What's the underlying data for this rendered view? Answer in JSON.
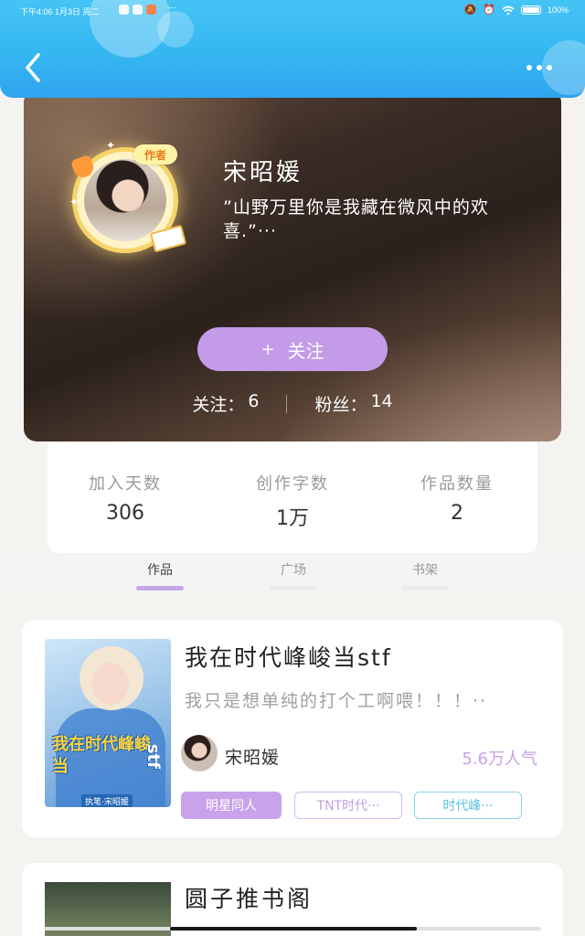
{
  "status_bar": {
    "time": "下午4:06  1月3日 周二",
    "dots": "···",
    "battery_pct": "100%"
  },
  "header": {
    "back_icon": "chevron-left-icon",
    "more_icon": "more-dots-icon"
  },
  "profile": {
    "badge": "作者",
    "name": "宋昭媛",
    "bio": "”山野万里你是我藏在微风中的欢喜.”···",
    "follow_button": "关注",
    "follow_plus": "+",
    "following_label": "关注：",
    "following_value": "6",
    "fans_label": "粉丝：",
    "fans_value": "14"
  },
  "stats": [
    {
      "label": "加入天数",
      "value": "306"
    },
    {
      "label": "创作字数",
      "value": "1万"
    },
    {
      "label": "作品数量",
      "value": "2"
    }
  ],
  "tabs": [
    {
      "label": "作品",
      "active": true
    },
    {
      "label": "广场",
      "active": false
    },
    {
      "label": "书架",
      "active": false
    }
  ],
  "books": [
    {
      "title": "我在时代峰峻当stf",
      "description": "我只是想单纯的打个工啊喂！！！··",
      "author": "宋昭媛",
      "readers": "5.6万人气",
      "cover_title": "我在时代峰峻当",
      "cover_side": "stf",
      "cover_author": "执笔·宋昭媛",
      "tags": [
        "明星同人",
        "TNT时代···",
        "时代峰···"
      ]
    },
    {
      "title": "圆子推书阁"
    }
  ],
  "colors": {
    "header_blue": "#35b6f1",
    "accent_purple": "#c39be8",
    "tag_blue": "#5bbfe0"
  }
}
